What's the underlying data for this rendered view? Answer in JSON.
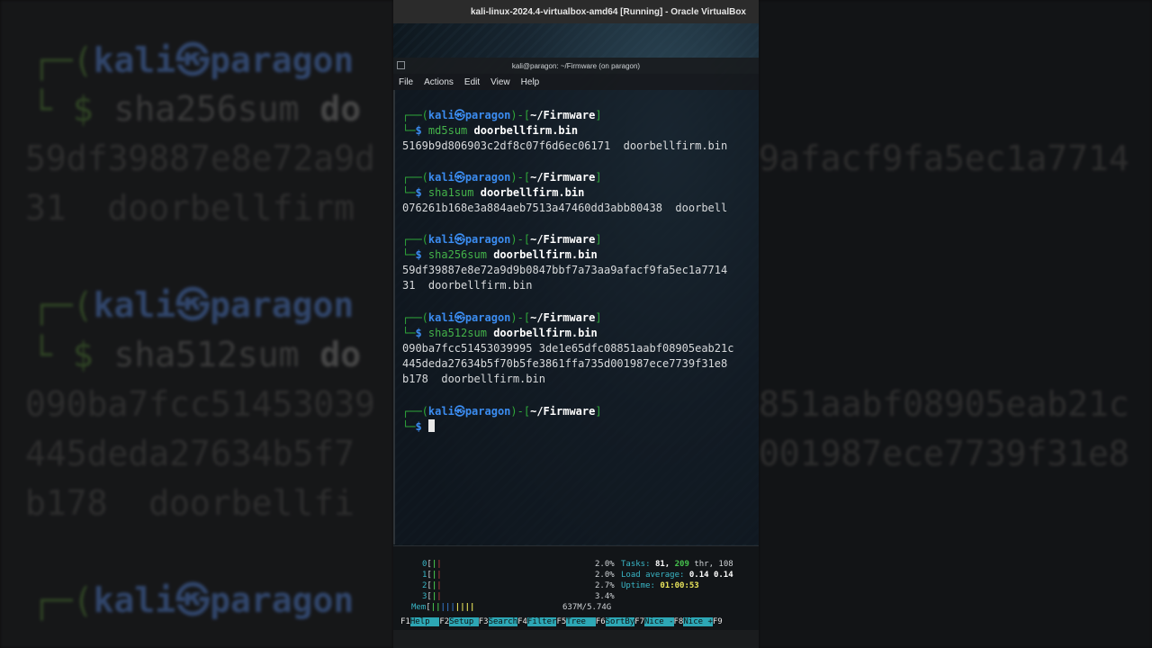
{
  "vbox_title": "kali-linux-2024.4-virtualbox-amd64 [Running] - Oracle VirtualBox",
  "term_title": "kali@paragon: ~/Firmware (on paragon)",
  "menu": [
    "File",
    "Actions",
    "Edit",
    "View",
    "Help"
  ],
  "prompt": {
    "open": "┌──(",
    "user": "kali",
    "at": "㉿",
    "host": "paragon",
    "close": ")-[",
    "path": "~/Firmware",
    "end": "]",
    "arrow": "└─",
    "dollar": "$"
  },
  "blocks": [
    {
      "cmd": "md5sum",
      "arg": "doorbellfirm.bin",
      "output": [
        "5169b9d806903c2df8c07f6d6ec06171  doorbellfirm.bin"
      ]
    },
    {
      "cmd": "sha1sum",
      "arg": "doorbellfirm.bin",
      "output": [
        "076261b168e3a884aeb7513a47460dd3abb80438  doorbell"
      ]
    },
    {
      "cmd": "sha256sum",
      "arg": "doorbellfirm.bin",
      "output": [
        "59df39887e8e72a9d9b0847bbf7a73aa9afacf9fa5ec1a7714",
        "31  doorbellfirm.bin"
      ]
    },
    {
      "cmd": "sha512sum",
      "arg": "doorbellfirm.bin",
      "output": [
        "090ba7fcc51453039995 3de1e65dfc08851aabf08905eab21c",
        "445deda27634b5f70b5fe3861ffa735d001987ece7739f31e8",
        "b178  doorbellfirm.bin"
      ]
    }
  ],
  "htop": {
    "cpus": [
      {
        "id": "0",
        "pct": "2.0%"
      },
      {
        "id": "1",
        "pct": "2.0%"
      },
      {
        "id": "2",
        "pct": "2.7%"
      },
      {
        "id": "3",
        "pct": "3.4%"
      }
    ],
    "mem_label": "Mem",
    "mem_value": "637M/5.74G",
    "tasks_label": "Tasks:",
    "tasks": "81,",
    "threads": "209",
    "threads_suffix": "thr, 108",
    "load_label": "Load average:",
    "load": "0.14 0.14",
    "uptime_label": "Uptime:",
    "uptime": "01:00:53",
    "fkeys": [
      {
        "key": "F1",
        "label": "Help  "
      },
      {
        "key": "F2",
        "label": "Setup "
      },
      {
        "key": "F3",
        "label": "Search"
      },
      {
        "key": "F4",
        "label": "Filter"
      },
      {
        "key": "F5",
        "label": "Tree  "
      },
      {
        "key": "F6",
        "label": "SortBy"
      },
      {
        "key": "F7",
        "label": "Nice -"
      },
      {
        "key": "F8",
        "label": "Nice +"
      },
      {
        "key": "F9",
        "label": ""
      }
    ]
  },
  "backdrop": {
    "lines": [
      {
        "text": "sha256sum",
        "arg": "do"
      },
      {
        "text": "59df39887e8e72a9d"
      },
      {
        "text": "31  doorbellfirm"
      },
      {
        "text": "sha512sum",
        "arg": "do"
      },
      {
        "text": "090ba7fcc51453039"
      },
      {
        "text": "445deda27634b5f7"
      },
      {
        "text": "b178  doorbellfi"
      }
    ],
    "right_lines": [
      "9afacf9fa5ec1a7714",
      "851aabf08905eab21c",
      "001987ece7739f31e8"
    ]
  }
}
